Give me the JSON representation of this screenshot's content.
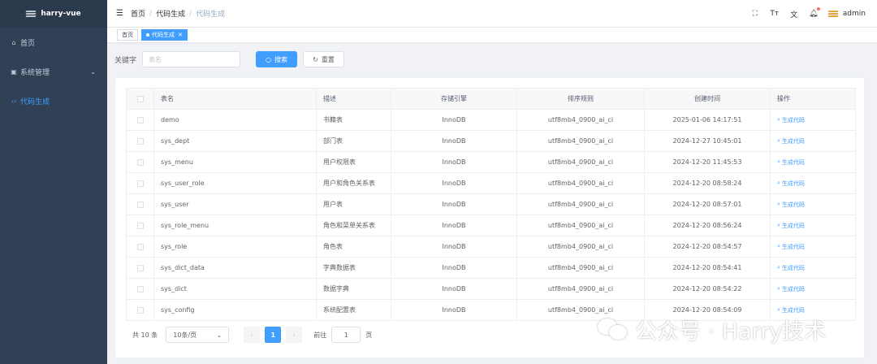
{
  "app": {
    "title": "harry-vue"
  },
  "sidebar": {
    "items": [
      {
        "label": "首页",
        "icon": "home-icon"
      },
      {
        "label": "系统管理",
        "icon": "monitor-icon"
      },
      {
        "label": "代码生成",
        "icon": "code-icon"
      }
    ],
    "active_color": "#409eff"
  },
  "header": {
    "breadcrumb": [
      "首页",
      "代码生成",
      "代码生成"
    ],
    "username": "admin"
  },
  "tags": [
    {
      "label": "首页"
    },
    {
      "label": "代码生成"
    }
  ],
  "search": {
    "label": "关键字",
    "placeholder": "表名",
    "search_label": "搜索",
    "reset_label": "重置"
  },
  "table": {
    "columns": [
      "表名",
      "描述",
      "存储引擎",
      "排序规则",
      "创建时间",
      "操作"
    ],
    "action_label": "生成代码",
    "rows": [
      {
        "name": "demo",
        "desc": "书籍表",
        "engine": "InnoDB",
        "collation": "utf8mb4_0900_ai_ci",
        "created": "2025-01-06 14:17:51"
      },
      {
        "name": "sys_dept",
        "desc": "部门表",
        "engine": "InnoDB",
        "collation": "utf8mb4_0900_ai_ci",
        "created": "2024-12-27 10:45:01"
      },
      {
        "name": "sys_menu",
        "desc": "用户权限表",
        "engine": "InnoDB",
        "collation": "utf8mb4_0900_ai_ci",
        "created": "2024-12-20 11:45:53"
      },
      {
        "name": "sys_user_role",
        "desc": "用户和角色关系表",
        "engine": "InnoDB",
        "collation": "utf8mb4_0900_ai_ci",
        "created": "2024-12-20 08:58:24"
      },
      {
        "name": "sys_user",
        "desc": "用户表",
        "engine": "InnoDB",
        "collation": "utf8mb4_0900_ai_ci",
        "created": "2024-12-20 08:57:01"
      },
      {
        "name": "sys_role_menu",
        "desc": "角色和菜单关系表",
        "engine": "InnoDB",
        "collation": "utf8mb4_0900_ai_ci",
        "created": "2024-12-20 08:56:24"
      },
      {
        "name": "sys_role",
        "desc": "角色表",
        "engine": "InnoDB",
        "collation": "utf8mb4_0900_ai_ci",
        "created": "2024-12-20 08:54:57"
      },
      {
        "name": "sys_dict_data",
        "desc": "字典数据表",
        "engine": "InnoDB",
        "collation": "utf8mb4_0900_ai_ci",
        "created": "2024-12-20 08:54:41"
      },
      {
        "name": "sys_dict",
        "desc": "数据字典",
        "engine": "InnoDB",
        "collation": "utf8mb4_0900_ai_ci",
        "created": "2024-12-20 08:54:22"
      },
      {
        "name": "sys_config",
        "desc": "系统配置表",
        "engine": "InnoDB",
        "collation": "utf8mb4_0900_ai_ci",
        "created": "2024-12-20 08:54:09"
      }
    ]
  },
  "pagination": {
    "total_label": "共 10 条",
    "page_size_label": "10条/页",
    "current_page": "1",
    "goto_label": "前往",
    "goto_value": "1",
    "page_unit": "页"
  },
  "watermark": {
    "text": "公众号 · Harry技术"
  }
}
